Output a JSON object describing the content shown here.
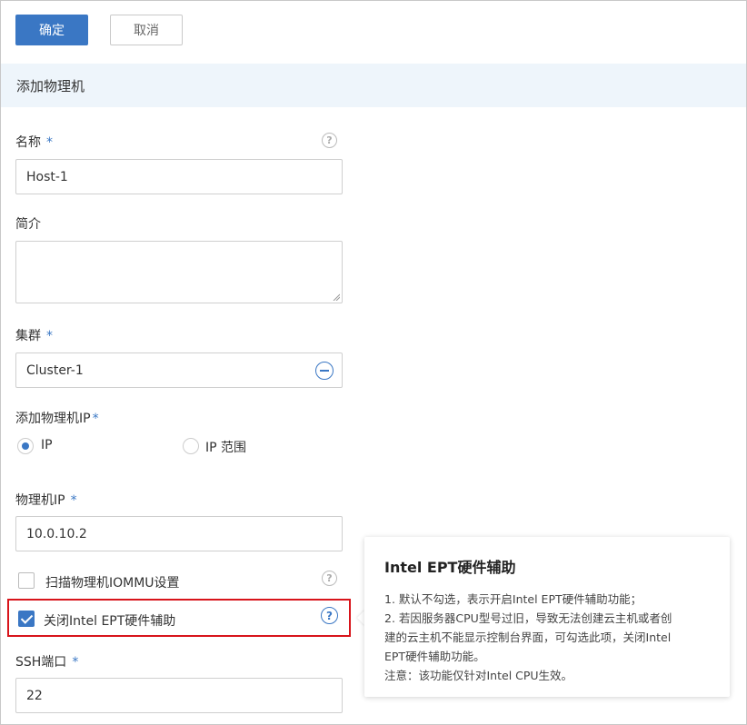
{
  "toolbar": {
    "confirm_label": "确定",
    "cancel_label": "取消"
  },
  "section": {
    "title": "添加物理机"
  },
  "form": {
    "name": {
      "label": "名称",
      "required": "*",
      "value": "Host-1"
    },
    "description": {
      "label": "简介",
      "value": ""
    },
    "cluster": {
      "label": "集群",
      "required": "*",
      "value": "Cluster-1"
    },
    "add_ip": {
      "label": "添加物理机IP",
      "required": "*",
      "options": [
        "IP",
        "IP 范围"
      ],
      "selected": "IP"
    },
    "host_ip": {
      "label": "物理机IP",
      "required": "*",
      "value": "10.0.10.2"
    },
    "scan_iommu": {
      "label": "扫描物理机IOMMU设置",
      "checked": false
    },
    "disable_ept": {
      "label": "关闭Intel EPT硬件辅助",
      "checked": true
    },
    "ssh_port": {
      "label": "SSH端口",
      "required": "*",
      "value": "22"
    }
  },
  "tooltip": {
    "title": "Intel EPT硬件辅助",
    "lines": [
      "1. 默认不勾选，表示开启Intel EPT硬件辅助功能；",
      "2. 若因服务器CPU型号过旧，导致无法创建云主机或者创",
      "建的云主机不能显示控制台界面，可勾选此项，关闭Intel",
      "EPT硬件辅助功能。",
      "注意：该功能仅针对Intel CPU生效。"
    ]
  },
  "icons": {
    "help": "?"
  },
  "colors": {
    "accent": "#3a77c4",
    "highlight": "#d8141b",
    "header_bg": "#eef5fb"
  }
}
